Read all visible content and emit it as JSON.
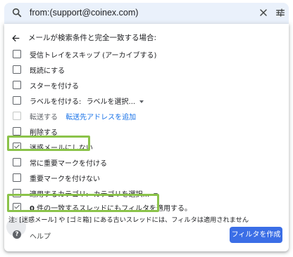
{
  "search": {
    "query": "from:(support@coinex.com)"
  },
  "filter": {
    "header": "メールが検索条件と完全一致する場合:",
    "options": [
      {
        "label": "受信トレイをスキップ (アーカイブする)",
        "checked": false
      },
      {
        "label": "既読にする",
        "checked": false
      },
      {
        "label": "スターを付ける",
        "checked": false
      },
      {
        "label": "ラベルを付ける:",
        "dropdown": "ラベルを選択...",
        "checked": false
      },
      {
        "label": "転送する",
        "link": "転送先アドレスを追加",
        "checked": false,
        "disabled": true
      },
      {
        "label": "削除する",
        "checked": false
      },
      {
        "label": "迷惑メールにしない",
        "checked": true
      },
      {
        "label": "常に重要マークを付ける",
        "checked": false
      },
      {
        "label": "重要マークを付けない",
        "checked": false
      },
      {
        "label": "適用するカテゴリ:",
        "dropdown": "カテゴリを選択...",
        "checked": false
      }
    ],
    "apply_existing": {
      "count": "0",
      "label": " 件の一致するスレッドにもフィルタを適用する。",
      "checked": true
    },
    "note": "注: [迷惑メール] や [ゴミ箱] にある古いスレッドには、フィルタは適用されません",
    "help_label": "ヘルプ",
    "create_button": "フィルタを作成"
  },
  "colors": {
    "accent": "#3b6ee6",
    "highlight": "#8bc34a",
    "searchbar_bg": "#eaf1fb"
  }
}
